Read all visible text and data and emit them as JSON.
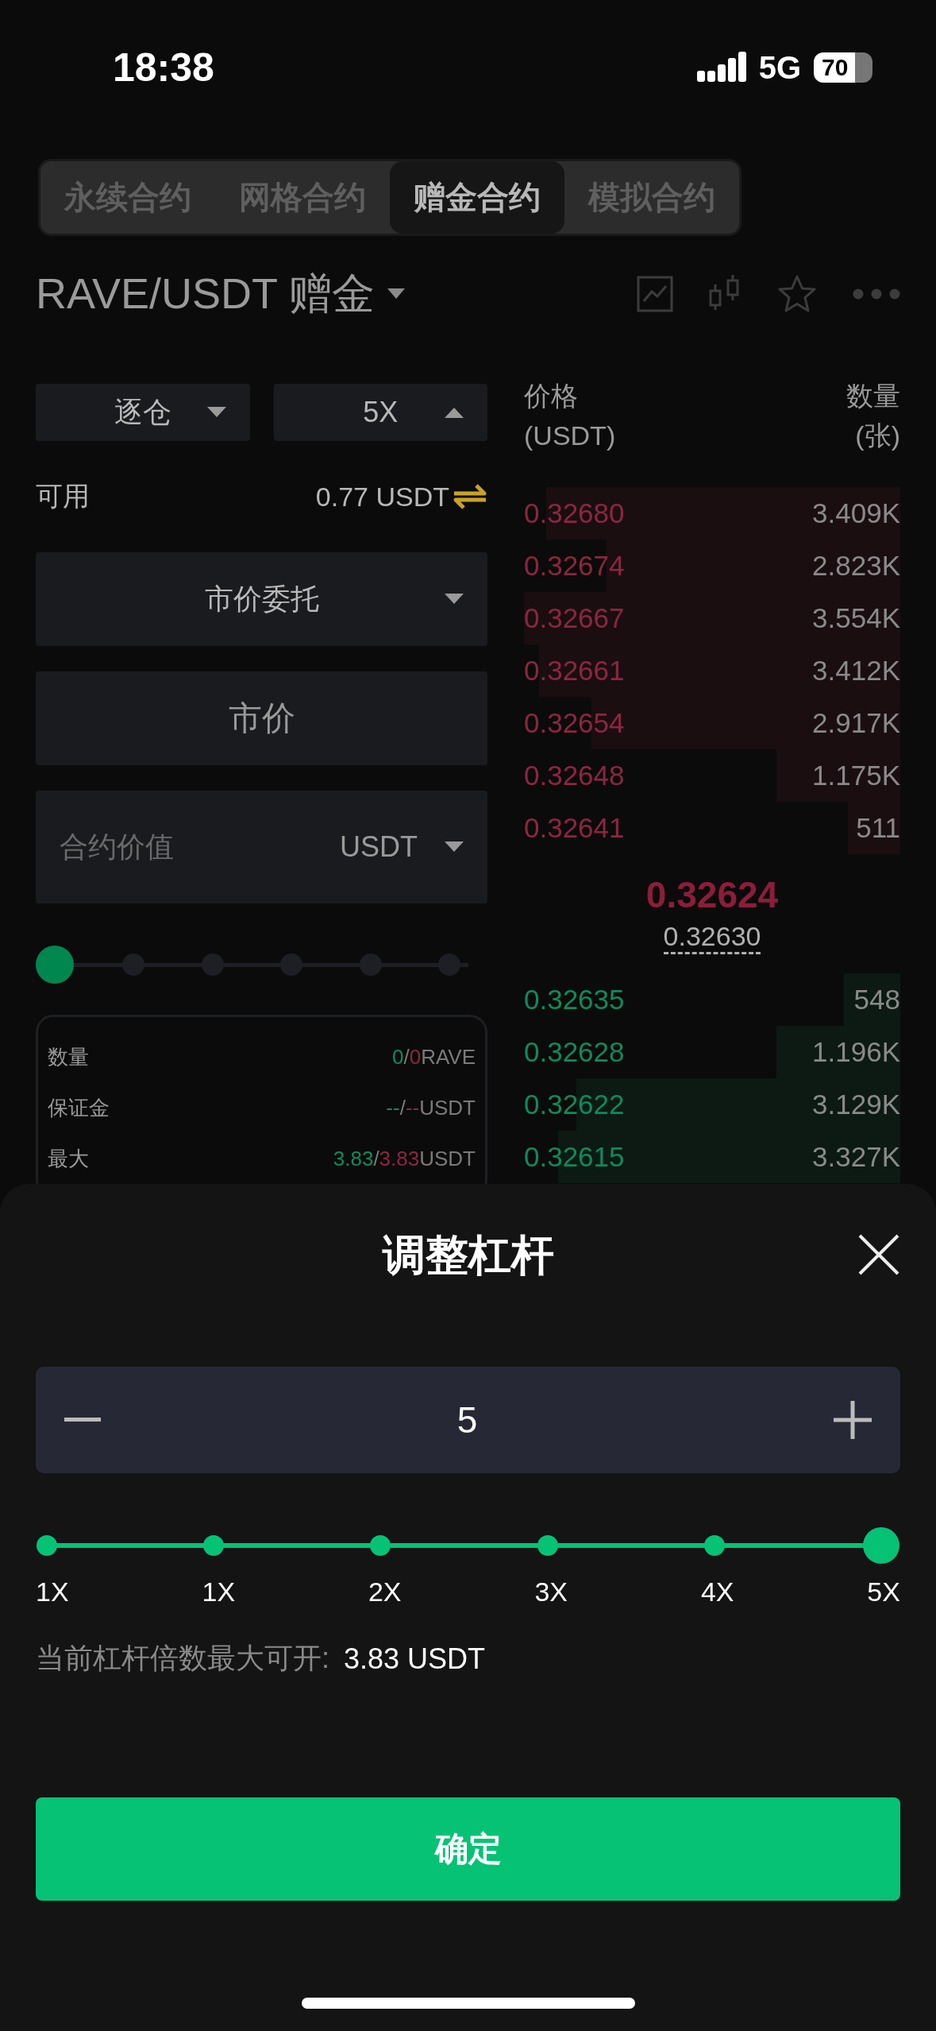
{
  "status_bar": {
    "time": "18:38",
    "network": "5G",
    "battery": "70"
  },
  "tabs": [
    {
      "label": "永续合约",
      "selected": false
    },
    {
      "label": "网格合约",
      "selected": false
    },
    {
      "label": "赠金合约",
      "selected": true
    },
    {
      "label": "模拟合约",
      "selected": false
    }
  ],
  "pair": {
    "title": "RAVE/USDT 赠金"
  },
  "order_form": {
    "margin_mode": {
      "label": "逐仓",
      "expanded": false
    },
    "leverage": {
      "label": "5X",
      "expanded": true
    },
    "available": {
      "label": "可用",
      "value": "0.77 USDT"
    },
    "order_type": {
      "label": "市价委托"
    },
    "price": {
      "value": "市价"
    },
    "amount": {
      "placeholder": "合约价值",
      "unit": "USDT"
    },
    "slider": {
      "level": 0
    },
    "info": [
      {
        "label": "数量",
        "value": [
          {
            "text": "0",
            "kind": "long"
          },
          {
            "text": "/",
            "kind": "plain"
          },
          {
            "text": "0",
            "kind": "short"
          },
          {
            "text": "RAVE",
            "kind": "plain"
          }
        ]
      },
      {
        "label": "保证金",
        "value": [
          {
            "text": "--",
            "kind": "long"
          },
          {
            "text": "/",
            "kind": "plain"
          },
          {
            "text": "--",
            "kind": "short"
          },
          {
            "text": "USDT",
            "kind": "plain"
          }
        ]
      },
      {
        "label": "最大",
        "value": [
          {
            "text": "3.83",
            "kind": "long"
          },
          {
            "text": "/",
            "kind": "plain"
          },
          {
            "text": "3.83",
            "kind": "short"
          },
          {
            "text": "USDT",
            "kind": "plain"
          }
        ]
      }
    ]
  },
  "order_book": {
    "price_header": [
      "价格",
      "(USDT)"
    ],
    "amount_header": [
      "数量",
      "(张)"
    ],
    "asks": [
      {
        "price": "0.32680",
        "amount": "3.409K",
        "level": 0.94
      },
      {
        "price": "0.32674",
        "amount": "2.823K",
        "level": 0.78
      },
      {
        "price": "0.32667",
        "amount": "3.554K",
        "level": 1.0
      },
      {
        "price": "0.32661",
        "amount": "3.412K",
        "level": 0.96
      },
      {
        "price": "0.32654",
        "amount": "2.917K",
        "level": 0.82
      },
      {
        "price": "0.32648",
        "amount": "1.175K",
        "level": 0.33
      },
      {
        "price": "0.32641",
        "amount": "511",
        "level": 0.14
      }
    ],
    "last_price": "0.32624",
    "mark_price": "0.32630",
    "bids": [
      {
        "price": "0.32635",
        "amount": "548",
        "level": 0.15
      },
      {
        "price": "0.32628",
        "amount": "1.196K",
        "level": 0.33
      },
      {
        "price": "0.32622",
        "amount": "3.129K",
        "level": 0.86
      },
      {
        "price": "0.32615",
        "amount": "3.327K",
        "level": 0.91
      }
    ]
  },
  "leverage_sheet": {
    "title": "调整杠杆",
    "value": "5",
    "ticks": [
      {
        "label": "1X",
        "selected": false
      },
      {
        "label": "1X",
        "selected": false
      },
      {
        "label": "2X",
        "selected": false
      },
      {
        "label": "3X",
        "selected": false
      },
      {
        "label": "4X",
        "selected": false
      },
      {
        "label": "5X",
        "selected": true
      }
    ],
    "max_label": "当前杠杆倍数最大可开:",
    "max_value": "3.83 USDT",
    "confirm": "确定"
  }
}
